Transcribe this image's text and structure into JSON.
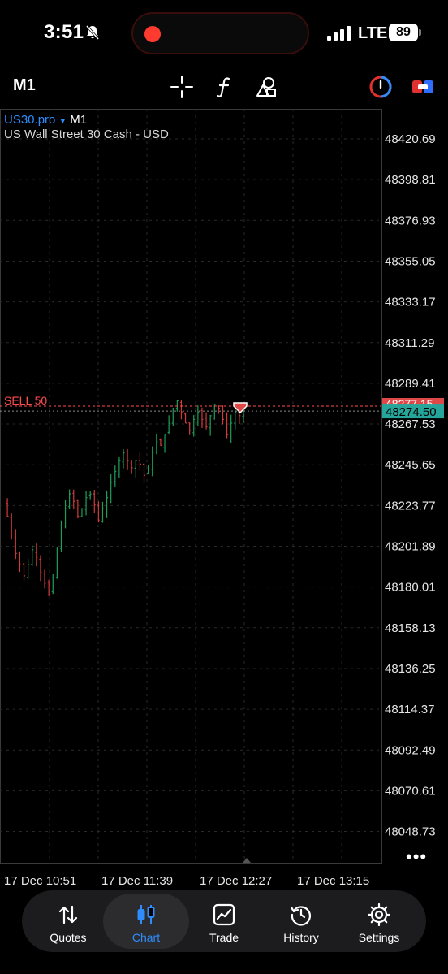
{
  "status_bar": {
    "time": "3:51",
    "network": "LTE",
    "battery": "89",
    "icons": [
      "bell-slash-icon",
      "record-dot-icon",
      "signal-bars-icon"
    ]
  },
  "toolbar": {
    "timeframe": "M1",
    "icons": [
      "crosshair-icon",
      "function-icon",
      "objects-icon",
      "one-click-trading-icon",
      "trade-toggle-icon"
    ]
  },
  "chart": {
    "symbol": "US30.pro",
    "timeframe": "M1",
    "description": "US Wall Street 30 Cash - USD",
    "order_line_label": "SELL 50",
    "order_price_partial": "48277.15",
    "current_price": "48274.50",
    "price_labels": [
      "48420.69",
      "48398.81",
      "48376.93",
      "48355.05",
      "48333.17",
      "48311.29",
      "48289.41",
      "48267.53",
      "48245.65",
      "48223.77",
      "48201.89",
      "48180.01",
      "48158.13",
      "48136.25",
      "48114.37",
      "48092.49",
      "48070.61",
      "48048.73"
    ],
    "time_labels": [
      "17 Dec 10:51",
      "17 Dec 11:39",
      "17 Dec 12:27",
      "17 Dec 13:15"
    ],
    "more": "•••",
    "colors": {
      "bull": "#1f9e5a",
      "bear": "#d23a3a",
      "order_line": "#ff4d4d",
      "price_tag": "#26a69a",
      "grid": "#2a2a2a"
    }
  },
  "chart_data": {
    "type": "candlestick",
    "symbol": "US30.pro",
    "timeframe": "M1",
    "ylim": [
      48035,
      48440
    ],
    "y_ticks": [
      48420.69,
      48398.81,
      48376.93,
      48355.05,
      48333.17,
      48311.29,
      48289.41,
      48267.53,
      48245.65,
      48223.77,
      48201.89,
      48180.01,
      48158.13,
      48136.25,
      48114.37,
      48092.49,
      48070.61,
      48048.73
    ],
    "x_ticks": [
      "17 Dec 10:51",
      "17 Dec 11:39",
      "17 Dec 12:27",
      "17 Dec 13:15"
    ],
    "sell_order_price": 48277.15,
    "current_price": 48274.5,
    "approx_close_path": [
      48225,
      48218,
      48208,
      48198,
      48192,
      48186,
      48192,
      48200,
      48196,
      48188,
      48182,
      48176,
      48185,
      48200,
      48214,
      48222,
      48230,
      48226,
      48218,
      48222,
      48228,
      48230,
      48224,
      48216,
      48222,
      48228,
      48236,
      48242,
      48248,
      48252,
      48248,
      48244,
      48248,
      48246,
      48240,
      48244,
      48252,
      48258,
      48256,
      48262,
      48268,
      48276,
      48280,
      48274,
      48268,
      48264,
      48270,
      48274,
      48270,
      48266,
      48272,
      48278,
      48276,
      48270,
      48262,
      48268,
      48274,
      48272,
      48275
    ]
  },
  "bottom_nav": {
    "items": [
      {
        "label": "Quotes",
        "icon": "quotes-arrows-icon"
      },
      {
        "label": "Chart",
        "icon": "candlestick-icon"
      },
      {
        "label": "Trade",
        "icon": "trade-chart-icon"
      },
      {
        "label": "History",
        "icon": "history-clock-icon"
      },
      {
        "label": "Settings",
        "icon": "gear-icon"
      }
    ],
    "active": "Chart"
  }
}
